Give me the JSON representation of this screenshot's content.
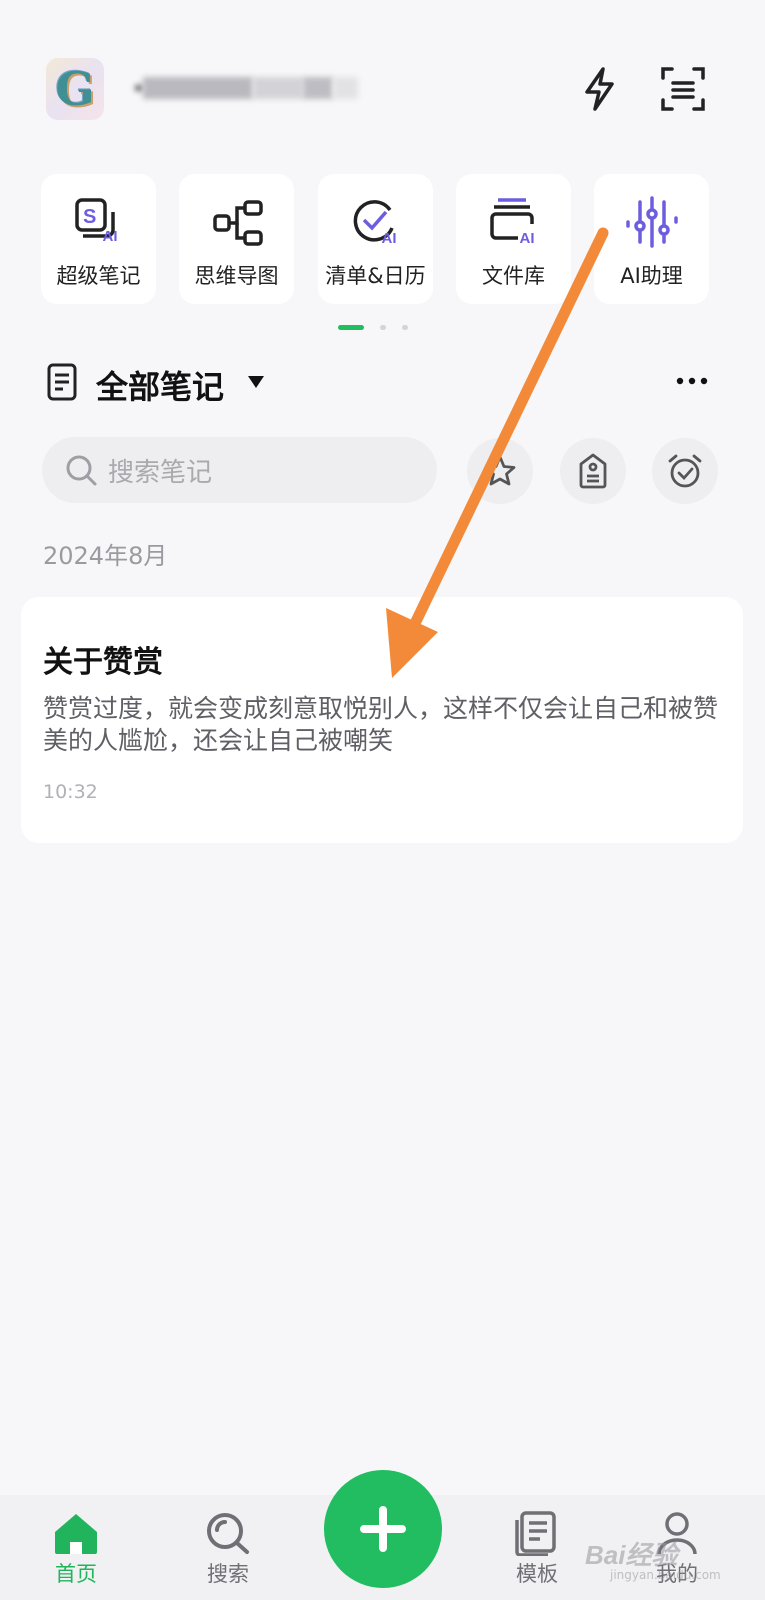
{
  "header": {
    "avatar_letter": "G",
    "icons": [
      "flash-icon",
      "scan-icon"
    ]
  },
  "features": [
    {
      "label": "超级笔记",
      "icon": "super-note-icon",
      "ai": "AI"
    },
    {
      "label": "思维导图",
      "icon": "mind-map-icon",
      "ai": ""
    },
    {
      "label": "清单&日历",
      "icon": "checklist-icon",
      "ai": "AI"
    },
    {
      "label": "文件库",
      "icon": "file-library-icon",
      "ai": "AI"
    },
    {
      "label": "AI助理",
      "icon": "ai-assistant-icon",
      "ai": ""
    }
  ],
  "pager": {
    "pages": 3,
    "active": 1
  },
  "section": {
    "title": "全部笔记"
  },
  "search": {
    "placeholder": "搜索笔记"
  },
  "filters": [
    "star-icon",
    "tag-icon",
    "alarm-icon"
  ],
  "notes_group": {
    "date": "2024年8月",
    "notes": [
      {
        "title": "关于赞赏",
        "excerpt": "赞赏过度，就会变成刻意取悦别人，这样不仅会让自己和被赞美的人尴尬，还会让自己被嘲笑",
        "time": "10:32"
      }
    ]
  },
  "bottom_nav": {
    "items": [
      {
        "label": "首页",
        "icon": "home-icon",
        "active": true
      },
      {
        "label": "搜索",
        "icon": "search-icon",
        "active": false
      },
      {
        "label": "模板",
        "icon": "template-icon",
        "active": false
      },
      {
        "label": "我的",
        "icon": "profile-icon",
        "active": false
      }
    ],
    "fab_icon": "plus-icon"
  },
  "watermark": {
    "text": "Bai经验",
    "sub": "jingyan.baidu.com"
  },
  "colors": {
    "accent": "#22bd60",
    "ai_purple": "#6d5ee0",
    "annotation_arrow": "#f28a3a"
  }
}
